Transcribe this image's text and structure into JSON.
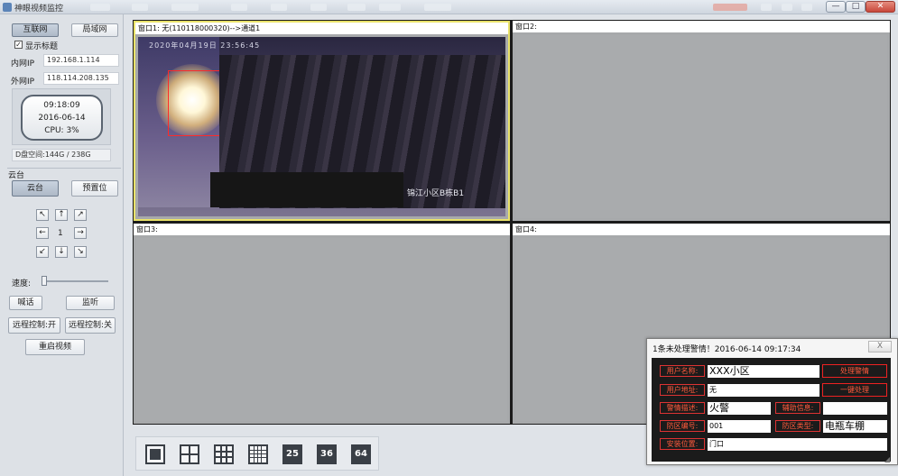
{
  "window": {
    "title": "神眼视频监控"
  },
  "win_controls": {
    "minimize": "—",
    "maximize": "□",
    "close": "✕"
  },
  "left": {
    "internet_btn": "互联网",
    "lan_btn": "局域网",
    "show_title_label": "显示标题",
    "show_title_checked": "✓",
    "inner_ip_label": "内网IP",
    "inner_ip": "192.168.1.114",
    "outer_ip_label": "外网IP",
    "outer_ip": "118.114.208.135",
    "clock": {
      "time": "09:18:09",
      "date": "2016-06-14",
      "cpu": "CPU: 3%"
    },
    "disk": "D盘空间:144G / 238G",
    "ptz_section": "云台",
    "ptz_btn": "云台",
    "preset_btn": "预置位",
    "arrows": {
      "ul": "↖",
      "up": "↑",
      "ur": "↗",
      "left": "←",
      "center": "1",
      "right": "→",
      "dl": "↙",
      "down": "↓",
      "dr": "↘"
    },
    "speed_label": "速度:",
    "talk_btn": "喊话",
    "listen_btn": "监听",
    "remote_on_btn": "远程控制:开",
    "remote_off_btn": "远程控制:关",
    "restart_btn": "重启视频"
  },
  "panes": {
    "p1": {
      "title": "窗口1: 无(110118000320)-->通道1",
      "osd_date": "2020年04月19日 23:56:45",
      "osd_location": "锦江小区B栋B1"
    },
    "p2": {
      "title": "窗口2:"
    },
    "p3": {
      "title": "窗口3:"
    },
    "p4": {
      "title": "窗口4:"
    }
  },
  "layouts": {
    "l25": "25",
    "l36": "36",
    "l64": "64"
  },
  "alert": {
    "title": "1条未处理警情！2016-06-14 09:17:34",
    "close": "X",
    "user_name_label": "用户名称:",
    "user_name": "XXX小区",
    "user_addr_label": "用户地址:",
    "user_addr": "无",
    "desc_label": "警情描述:",
    "desc": "火警",
    "aux_label": "辅助信息:",
    "aux": "",
    "zone_no_label": "防区编号:",
    "zone_no": "001",
    "zone_type_label": "防区类型:",
    "zone_type": "电瓶车棚",
    "install_label": "安装位置:",
    "install": "门口",
    "handle_btn": "处理警情",
    "onekey_btn": "一键处理"
  },
  "colors": {
    "accent_red": "#ff5a3c",
    "selected_pane": "#e9e26a",
    "video_bg": "#1b1b1b"
  }
}
